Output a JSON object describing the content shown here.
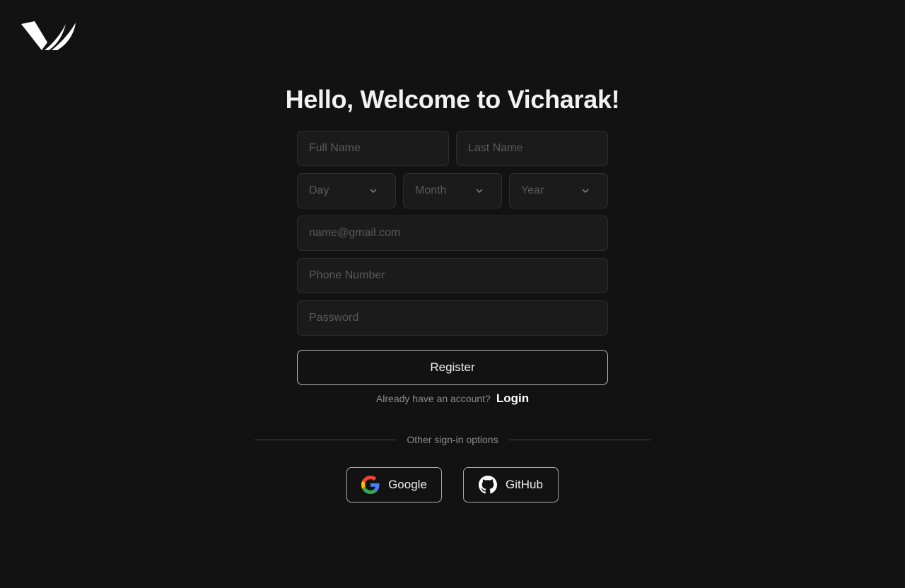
{
  "brand": {
    "logo_icon": "vicharak-logo-icon"
  },
  "title": "Hello, Welcome to Vicharak!",
  "form": {
    "full_name_placeholder": "Full Name",
    "last_name_placeholder": "Last Name",
    "day_label": "Day",
    "month_label": "Month",
    "year_label": "Year",
    "email_placeholder": "name@gmail.com",
    "phone_placeholder": "Phone Number",
    "password_placeholder": "Password",
    "register_label": "Register"
  },
  "login_prompt": {
    "text": "Already have an account?",
    "link": "Login"
  },
  "other_options": {
    "label": "Other sign-in options",
    "google_label": "Google",
    "github_label": "GitHub"
  },
  "colors": {
    "background": "#121212",
    "field_bg": "#1b1b1b",
    "field_border": "#2e2e2e",
    "google_blue": "#4285F4",
    "google_red": "#EA4335",
    "google_yellow": "#FBBC05",
    "google_green": "#34A853"
  }
}
